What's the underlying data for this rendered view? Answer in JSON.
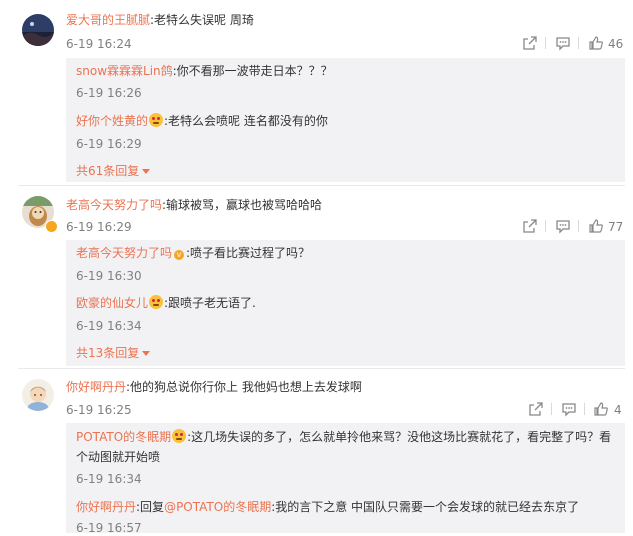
{
  "comments": [
    {
      "user": "爱大哥的王腻腻",
      "text": ":老特么失误呢 周琦",
      "time": "6-19 16:24",
      "likes": "46",
      "replies": [
        {
          "user": "snow霖霖霖Lin鸽",
          "text": ":你不看那一波带走日本？？？",
          "time": "6-19 16:26"
        },
        {
          "user": "好你个姓黄的",
          "text": ":老特么会喷呢 连名都没有的你",
          "time": "6-19 16:29"
        }
      ],
      "more": "共61条回复"
    },
    {
      "user": "老高今天努力了吗",
      "text": ":输球被骂，赢球也被骂哈哈哈",
      "time": "6-19 16:29",
      "likes": "77",
      "replies": [
        {
          "user": "老高今天努力了吗",
          "text": ":喷子看比赛过程了吗？",
          "time": "6-19 16:30"
        },
        {
          "user": "欧豪的仙女儿",
          "text": ":跟喷子老无语了.",
          "time": "6-19 16:34"
        }
      ],
      "more": "共13条回复"
    },
    {
      "user": "你好啊丹丹",
      "text": ":他的狗总说你行你上 我他妈也想上去发球啊",
      "time": "6-19 16:25",
      "likes": "4",
      "replies": [
        {
          "user": "POTATO的冬眠期",
          "text": ":这几场失误的多了，怎么就单拎他来骂？没他这场比赛就花了，看完整了吗？看",
          "text2": "个动图就开始喷",
          "time": "6-19 16:34"
        },
        {
          "user": "你好啊丹丹",
          "text": ":回复",
          "mention": "@POTATO的冬眠期",
          "text_after": ":我的言下之意 中国队只需要一个会发球的就已经去东京了",
          "time": "6-19 16:57"
        }
      ]
    }
  ],
  "colors": {
    "username": "#eb7350",
    "meta": "#808080",
    "reply_bg": "#f2f2f5"
  }
}
